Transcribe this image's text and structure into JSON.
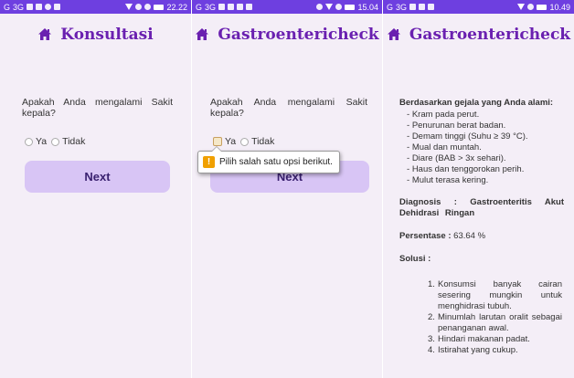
{
  "screens": [
    {
      "status": {
        "carrier": "G",
        "signal": "3G",
        "time": "22.22"
      },
      "title": "Konsultasi",
      "question": "Apakah Anda mengalami Sakit kepala?",
      "options": [
        "Ya",
        "Tidak"
      ],
      "next_label": "Next"
    },
    {
      "status": {
        "carrier": "G",
        "signal": "3G",
        "time": "15.04"
      },
      "title": "Gastroentericheck",
      "question": "Apakah Anda mengalami Sakit kepala?",
      "options": [
        "Ya",
        "Tidak"
      ],
      "next_label": "Next",
      "validation_message": "Pilih salah satu opsi berikut."
    },
    {
      "status": {
        "carrier": "G",
        "signal": "3G",
        "time": "10.49"
      },
      "title": "Gastroentericheck",
      "symptoms_heading": "Berdasarkan gejala yang Anda alami:",
      "symptoms": [
        "Kram pada perut.",
        "Penurunan berat badan.",
        "Demam tinggi (Suhu ≥ 39 °C).",
        "Mual dan muntah.",
        "Diare (BAB > 3x sehari).",
        "Haus dan tenggorokan perih.",
        "Mulut terasa kering."
      ],
      "diagnosis": "Diagnosis : Gastroenteritis Akut Dehidrasi Ringan",
      "percentage_label": "Persentase :",
      "percentage_value": "63.64 %",
      "solution_heading": "Solusi :",
      "solutions": [
        "Konsumsi banyak cairan sesering mungkin untuk menghidrasi tubuh.",
        "Minumlah larutan oralit sebagai penanganan awal.",
        "Hindari makanan padat.",
        "Istirahat yang cukup."
      ]
    }
  ],
  "colors": {
    "statusbar": "#6e3fe0",
    "title": "#6a20b0",
    "button": "#d8c5f5",
    "background": "#f4eef7"
  },
  "icons": {
    "title": "home-icon",
    "validation": "warning-icon"
  }
}
